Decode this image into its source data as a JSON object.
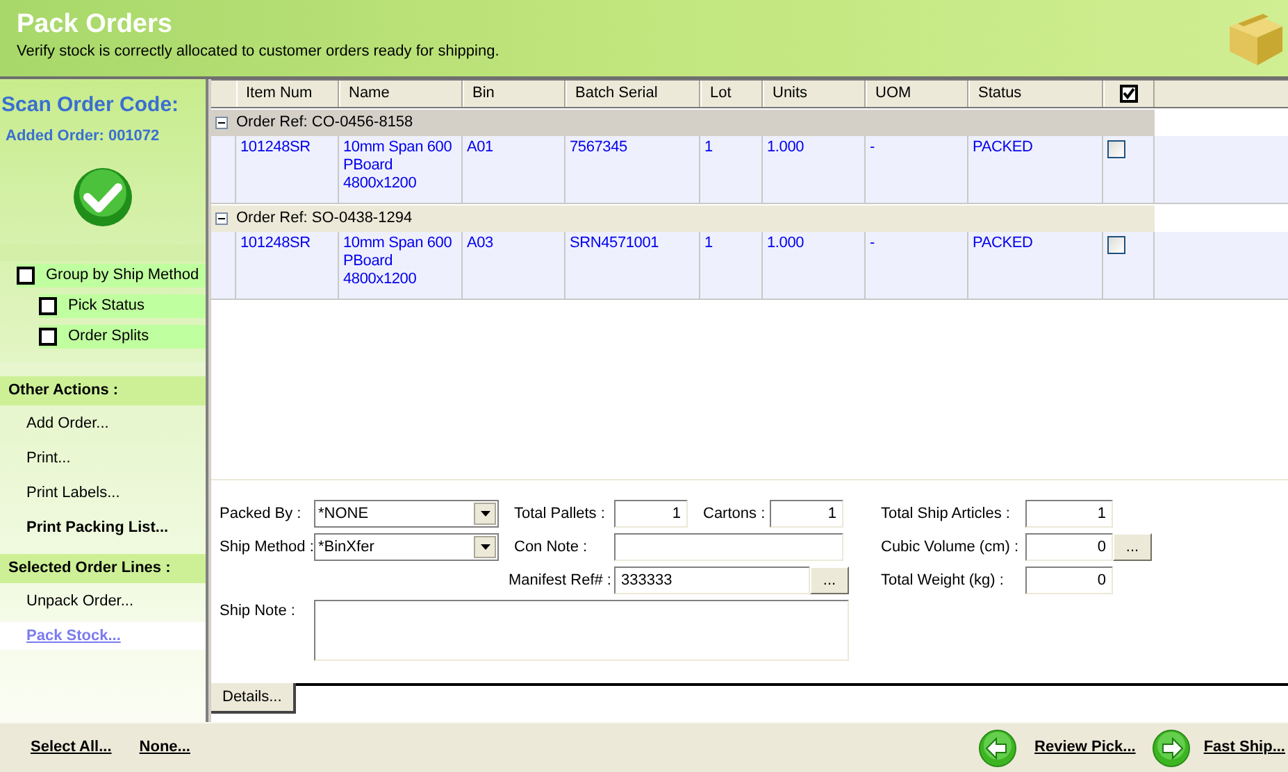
{
  "header": {
    "title": "Pack Orders",
    "subtitle": "Verify stock is correctly allocated to customer orders ready for shipping."
  },
  "sidebar": {
    "scan_label": "Scan Order Code:",
    "added_order": "Added Order: 001072",
    "options": [
      {
        "label": "Group by Ship Method",
        "checked": false,
        "kind": "main"
      },
      {
        "label": "Pick Status",
        "checked": false,
        "kind": "sub"
      },
      {
        "label": "Order Splits",
        "checked": false,
        "kind": "sub"
      }
    ],
    "sections": [
      {
        "title": "Other Actions :",
        "items": [
          {
            "label": "Add Order...",
            "kind": "normal",
            "selected": false
          },
          {
            "label": "Print...",
            "kind": "normal",
            "selected": false
          },
          {
            "label": "Print Labels...",
            "kind": "normal",
            "selected": false
          },
          {
            "label": "Print Packing List...",
            "kind": "bold",
            "selected": false
          }
        ]
      },
      {
        "title": "Selected Order Lines :",
        "items": [
          {
            "label": "Unpack Order...",
            "kind": "normal",
            "selected": false
          },
          {
            "label": "Pack Stock...",
            "kind": "normal",
            "selected": true
          }
        ]
      }
    ]
  },
  "grid": {
    "columns": [
      "Item Num",
      "Name",
      "Bin",
      "Batch Serial",
      "Lot",
      "Units",
      "UOM",
      "Status"
    ],
    "header_checkbox": {
      "checked": true
    },
    "groups": [
      {
        "label": "Order Ref: CO-0456-8158",
        "expanded": true,
        "selected": true,
        "rows": [
          {
            "cells": [
              "101248SR",
              "10mm Span 600 PBoard 4800x1200",
              "A01",
              "7567345",
              "1",
              "1.000",
              "-",
              "PACKED"
            ],
            "checked": false
          }
        ]
      },
      {
        "label": "Order Ref: SO-0438-1294",
        "expanded": true,
        "selected": false,
        "rows": [
          {
            "cells": [
              "101248SR",
              "10mm Span 600 PBoard 4800x1200",
              "A03",
              "SRN4571001",
              "1",
              "1.000",
              "-",
              "PACKED"
            ],
            "checked": false
          }
        ]
      }
    ]
  },
  "form": {
    "packed_by": {
      "label": "Packed By :",
      "value": "*NONE"
    },
    "ship_method": {
      "label": "Ship Method :",
      "value": "*BinXfer"
    },
    "total_pallets": {
      "label": "Total Pallets :",
      "value": "1"
    },
    "cartons": {
      "label": "Cartons :",
      "value": "1"
    },
    "con_note": {
      "label": "Con Note :"
    },
    "manifest_ref": {
      "label": "Manifest Ref# :",
      "value": "333333",
      "button": "..."
    },
    "ship_note": {
      "label": "Ship Note :"
    },
    "total_ship_articles": {
      "label": "Total Ship Articles :",
      "value": "1"
    },
    "cubic_volume": {
      "label": "Cubic Volume (cm) :",
      "value": "0",
      "button": "..."
    },
    "total_weight": {
      "label": "Total Weight (kg) :",
      "value": "0"
    }
  },
  "tabs": [
    {
      "label": "Details...",
      "selected": true
    }
  ],
  "footer": {
    "select_all": "Select All...",
    "none": "None...",
    "review_pick": "Review Pick...",
    "fast_ship": "Fast Ship..."
  }
}
